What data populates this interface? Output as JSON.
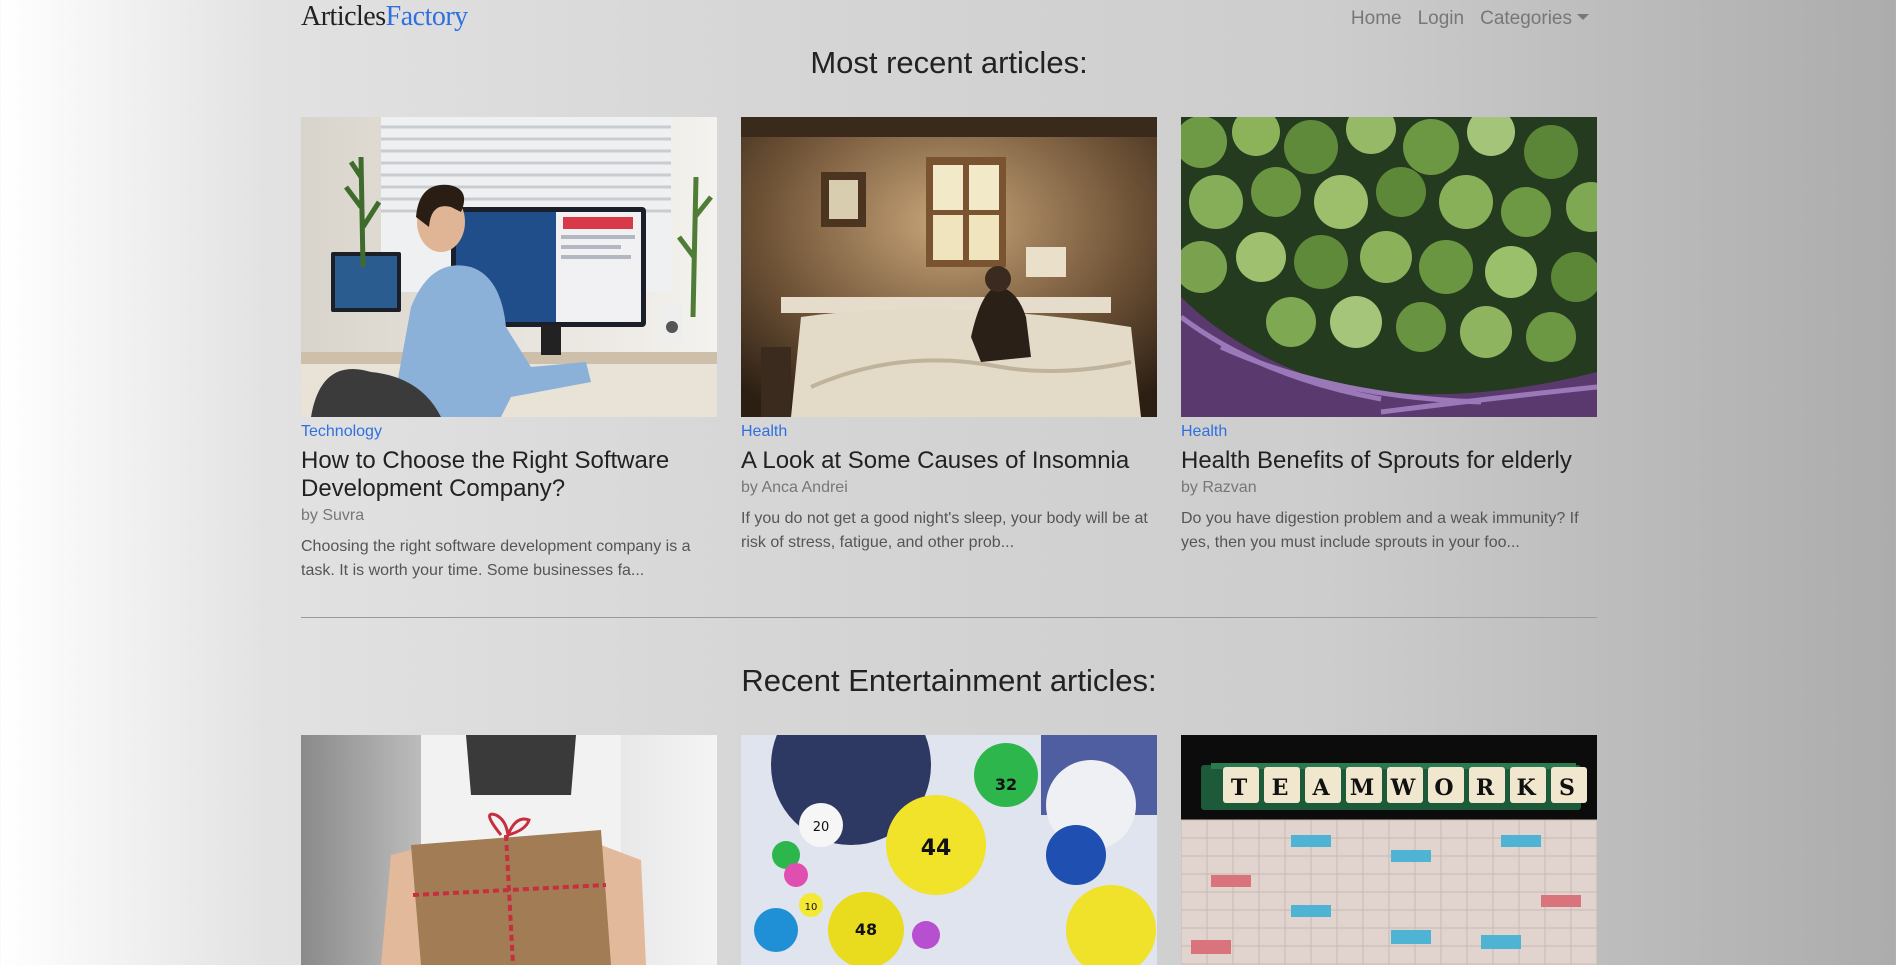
{
  "brand": {
    "part1": "Articles",
    "part2": "Factory"
  },
  "nav": {
    "home": "Home",
    "login": "Login",
    "categories": "Categories"
  },
  "sections": {
    "recent_title": "Most recent articles:",
    "entertainment_title": "Recent Entertainment articles:"
  },
  "recent_articles": [
    {
      "category": "Technology",
      "title": "How to Choose the Right Software Development Company?",
      "author": "by Suvra",
      "excerpt": "Choosing the right software development company is a task. It is worth your time. Some businesses fa..."
    },
    {
      "category": "Health",
      "title": "A Look at Some Causes of Insomnia",
      "author": "by Anca Andrei",
      "excerpt": "If you do not get a good night's sleep, your body will be at risk of stress, fatigue, and other prob..."
    },
    {
      "category": "Health",
      "title": "Health Benefits of Sprouts for elderly",
      "author": "by Razvan",
      "excerpt": "Do you have digestion problem and a weak immunity? If yes, then you must include sprouts in your foo..."
    }
  ],
  "scrabble_tiles": [
    "T",
    "E",
    "A",
    "M",
    "W",
    "O",
    "R",
    "K",
    "S"
  ],
  "lottery_ball_numbers": [
    "32",
    "20",
    "44",
    "48",
    "10"
  ],
  "colors": {
    "accent": "#2f6fe0",
    "text": "#222222",
    "muted": "#777777"
  }
}
